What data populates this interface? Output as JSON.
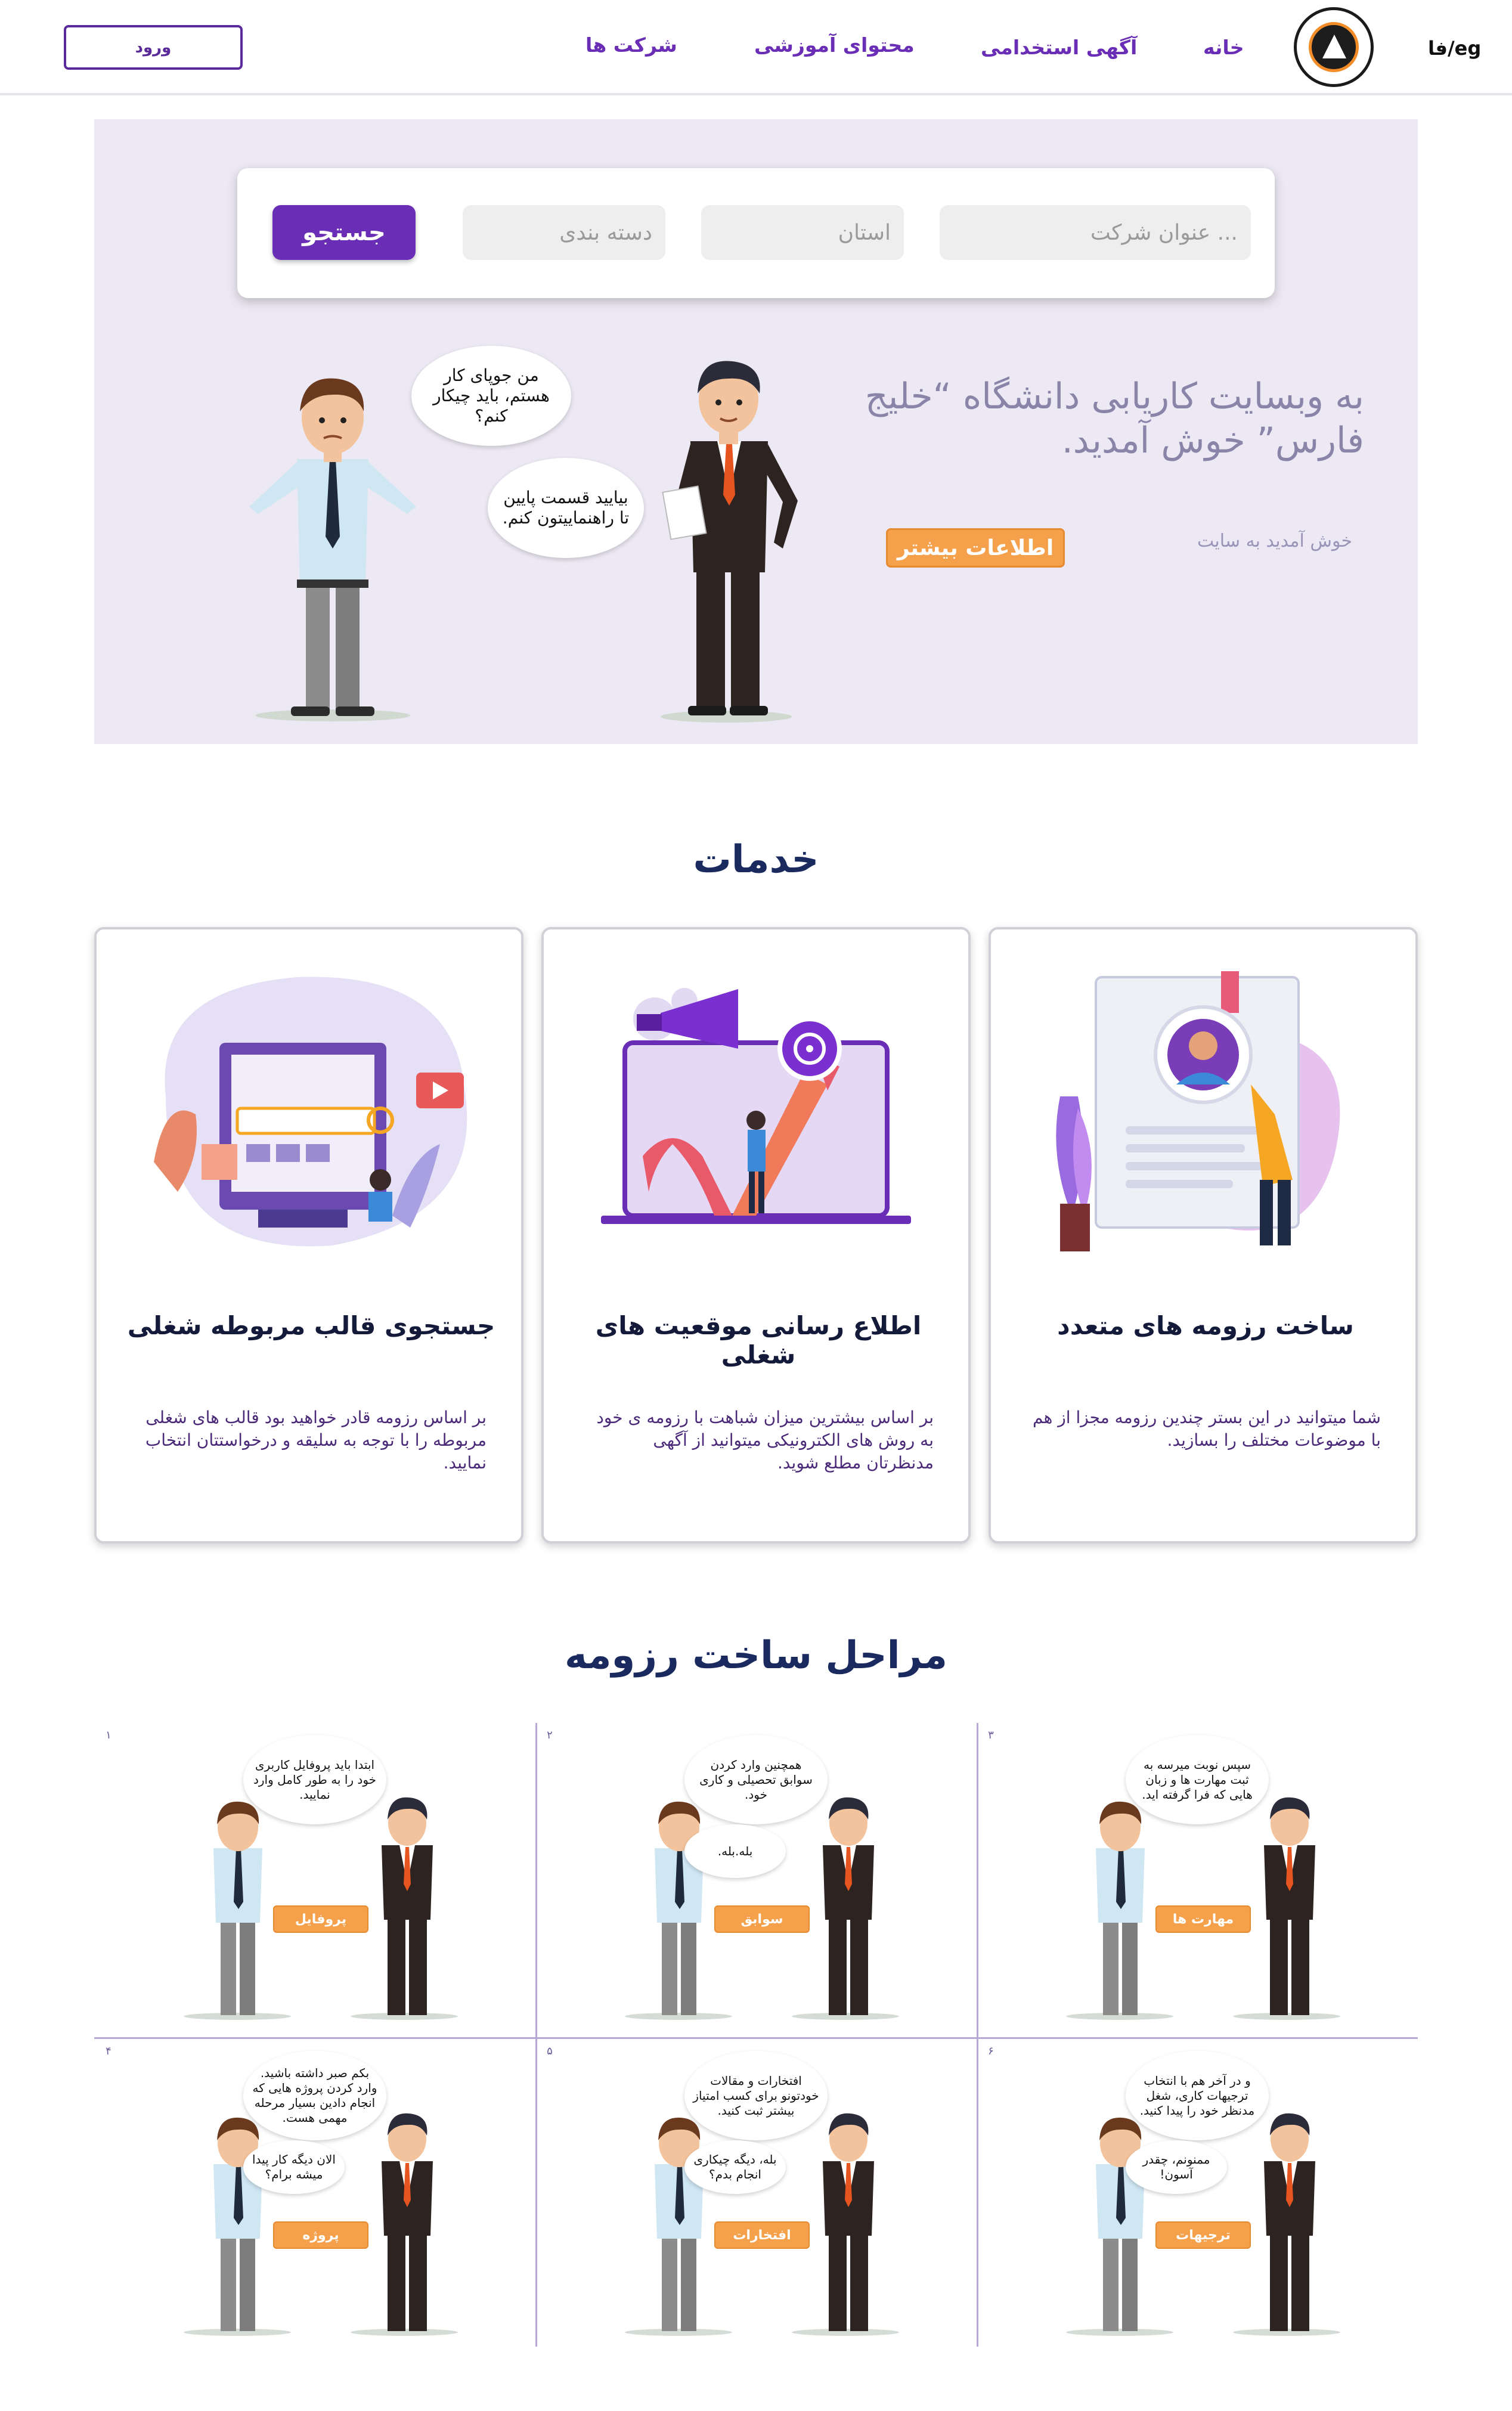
{
  "nav": {
    "lang": "فا/eg",
    "home": "خانه",
    "jobs": "آگهی استخدامی",
    "content": "محتوای آموزشی",
    "companies": "شرکت ها",
    "login": "ورود"
  },
  "search": {
    "title_placeholder": "عنوان شرکت ...",
    "province_placeholder": "استان",
    "category_placeholder": "دسته بندی",
    "button": "جستجو"
  },
  "hero": {
    "welcome": "به وبسایت کاریابی دانشگاه “خلیج فارس” خوش آمدید.",
    "subtitle": "خوش آمدید به سایت",
    "more_button": "اطلاعات بیشتر",
    "bubble_seeker": "من جوپای کار هستم، باید چیکار کنم؟",
    "bubble_guide": "بیایید قسمت پایین تا راهنماییتون کنم."
  },
  "services": {
    "title": "خدمات",
    "cards": [
      {
        "title": "ساخت رزومه های متعدد",
        "desc": "شما میتوانید در این بستر چندین رزومه مجزا از هم با موضوعات مختلف را بسازید."
      },
      {
        "title": "اطلاع رسانی موقعیت های شغلی",
        "desc": "بر اساس بیشترین میزان شباهت با رزومه ی خود به روش های الکترونیکی میتوانید از آگهی مدنظرتان مطلع شوید."
      },
      {
        "title": "جستجوی قالب مربوطه شغلی",
        "desc": "بر اساس رزومه قادر خواهید بود قالب های شغلی مربوطه را با توجه به سلیقه و درخواستتان  انتخاب نمایید."
      }
    ]
  },
  "steps": {
    "title": "مراحل ساخت رزومه",
    "items": [
      {
        "num": "۱",
        "tag": "پروفایل",
        "bubble": "ابتدا باید پروفایل کاربری خود را به طور کامل وارد نمایید.",
        "reply": ""
      },
      {
        "num": "۲",
        "tag": "سوابق",
        "bubble": "همچنین وارد کردن سوابق تحصیلی و کاری خود.",
        "reply": "بله.بله."
      },
      {
        "num": "۳",
        "tag": "مهارت ها",
        "bubble": "سپس نوبت میرسه به ثبت مهارت ها و زبان هایی که فرا گرفته اید.",
        "reply": ""
      },
      {
        "num": "۴",
        "tag": "پروژه",
        "bubble": "بکم صبر داشته باشید. وارد کردن پروژه هایی که انجام دادین بسیار مرحله مهمی هست.",
        "reply": "الان دیگه کار پیدا میشه برام؟"
      },
      {
        "num": "۵",
        "tag": "افتخارات",
        "bubble": "افتخارات و مقالات خودتونو برای کسب امتیاز بیشتر ثبت کنید.",
        "reply": "بله، دیگه چیکاری انجام بدم؟"
      },
      {
        "num": "۶",
        "tag": "ترجیهات",
        "bubble": "و در آخر هم با انتخاب ترجیهات کاری، شغل مدنظر خود را پیدا کنید.",
        "reply": "ممنونم، چقدر آسون!"
      }
    ]
  },
  "colors": {
    "accent": "#6a2db5",
    "orange": "#f5a04a",
    "hero_bg": "#ede9f4",
    "heading": "#1a2a5e"
  }
}
